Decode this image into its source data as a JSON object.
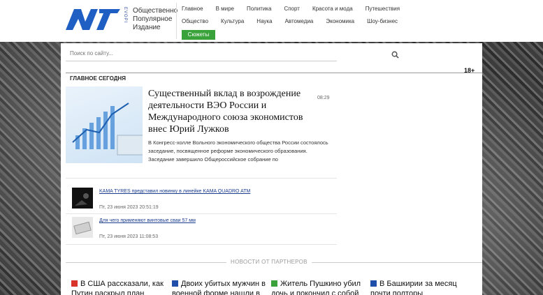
{
  "logo": {
    "mark": "N1",
    "side_text": "EVOPI",
    "lines": [
      "Общественно",
      "Популярное",
      "Издание"
    ]
  },
  "nav": {
    "row1": [
      "Главное",
      "В мире",
      "Политика",
      "Спорт",
      "Красота и мода",
      "Путешествия"
    ],
    "row2": [
      "Общество",
      "Культура",
      "Наука",
      "Автомедиа",
      "Экономика",
      "Шоу-бизнес"
    ],
    "stories_button": "Сюжеты"
  },
  "search": {
    "placeholder": "Поиск по сайту..."
  },
  "section": {
    "title": "ГЛАВНОЕ СЕГОДНЯ",
    "age": "18+"
  },
  "main_story": {
    "title": "Существенный вклад в возрождение деятельности ВЭО России и Международного союза экономистов внес Юрий Лужков",
    "time": "08:29",
    "lead": "В Конгресс-холле Вольного экономического общества России состоялось заседание, посвященное реформе экономического образования. Заседание завершило Общероссийское собрание по"
  },
  "items": [
    {
      "title": "KAMA TYRES представил новинку в линейке KAMA QUADRO ATM",
      "date": "Пт, 23 июня 2023 20:51:19"
    },
    {
      "title": "Для чего применяют винтовые сваи 57 мм",
      "date": "Пт, 23 июня 2023 11:08:53"
    }
  ],
  "partners": {
    "label": "НОВОСТИ ОТ ПАРТНЕРОВ"
  },
  "cards": [
    {
      "text": "В США рассказали, как Путин раскрыл план",
      "icon_color": "#d9342b"
    },
    {
      "text": "Двоих убитых мужчин в военной форме нашли в",
      "icon_color": "#1f4fa8"
    },
    {
      "text": "Житель Пушкино убил дочь и покончил с собой",
      "icon_color": "#3aa23a"
    },
    {
      "text": "В Башкирии за месяц почти полторы",
      "icon_color": "#1f4fa8"
    }
  ],
  "colors": {
    "accent_green": "#3aa23a",
    "link_blue": "#1a3d8f",
    "logo_blue": "#1f5fc4"
  }
}
